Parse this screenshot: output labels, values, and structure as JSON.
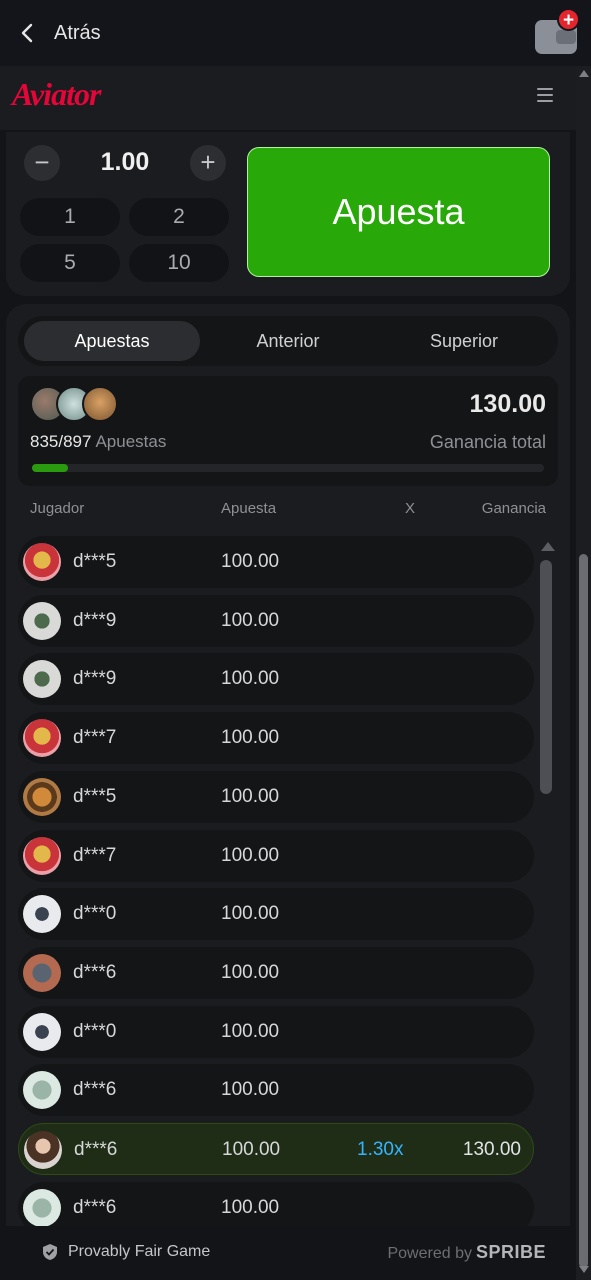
{
  "topbar": {
    "back_label": "Atrás"
  },
  "header": {
    "logo_text": "Aviator"
  },
  "bet_panel": {
    "amount": "1.00",
    "minus": "−",
    "plus": "+",
    "quick_amounts": [
      "1",
      "2",
      "5",
      "10"
    ],
    "bet_button_label": "Apuesta"
  },
  "tabs": [
    "Apuestas",
    "Anterior",
    "Superior"
  ],
  "summary": {
    "count": "835/897",
    "count_label": "Apuestas",
    "total_value": "130.00",
    "total_label": "Ganancia total",
    "progress_fraction": 0.07
  },
  "columns": {
    "player": "Jugador",
    "bet": "Apuesta",
    "x": "X",
    "win": "Ganancia"
  },
  "rows": [
    {
      "name": "d***5",
      "bet": "100.00",
      "mult": "",
      "win": "",
      "avatar": "lucky-cat"
    },
    {
      "name": "d***9",
      "bet": "100.00",
      "mult": "",
      "win": "",
      "avatar": "plane-green"
    },
    {
      "name": "d***9",
      "bet": "100.00",
      "mult": "",
      "win": "",
      "avatar": "plane-green"
    },
    {
      "name": "d***7",
      "bet": "100.00",
      "mult": "",
      "win": "",
      "avatar": "lucky-cat"
    },
    {
      "name": "d***5",
      "bet": "100.00",
      "mult": "",
      "win": "",
      "avatar": "tiger"
    },
    {
      "name": "d***7",
      "bet": "100.00",
      "mult": "",
      "win": "",
      "avatar": "lucky-cat"
    },
    {
      "name": "d***0",
      "bet": "100.00",
      "mult": "",
      "win": "",
      "avatar": "jet"
    },
    {
      "name": "d***6",
      "bet": "100.00",
      "mult": "",
      "win": "",
      "avatar": "robot"
    },
    {
      "name": "d***0",
      "bet": "100.00",
      "mult": "",
      "win": "",
      "avatar": "jet"
    },
    {
      "name": "d***6",
      "bet": "100.00",
      "mult": "",
      "win": "",
      "avatar": "money"
    },
    {
      "name": "d***6",
      "bet": "100.00",
      "mult": "1.30x",
      "win": "130.00",
      "avatar": "girl",
      "won": true
    },
    {
      "name": "d***6",
      "bet": "100.00",
      "mult": "",
      "win": "",
      "avatar": "money"
    }
  ],
  "footer": {
    "fair_label": "Provably Fair Game",
    "powered_label": "Powered by",
    "brand": "SPRIBE"
  },
  "colors": {
    "accent_red": "#e50539",
    "bet_green": "#28a909",
    "multiplier_blue": "#34b4ff"
  }
}
